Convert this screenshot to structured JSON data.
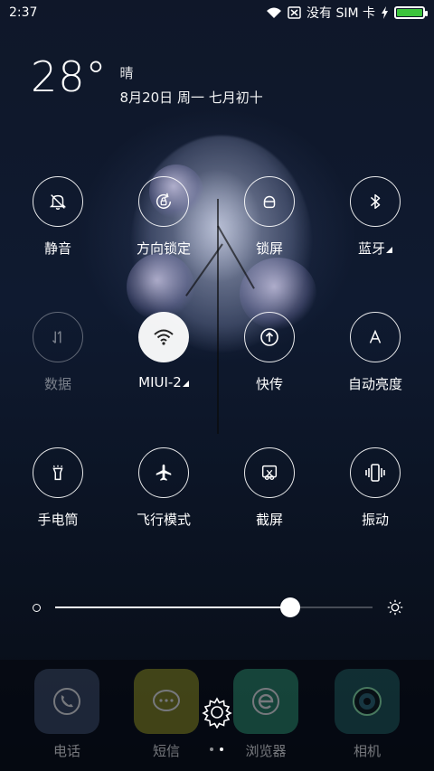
{
  "status_bar": {
    "time": "2:37",
    "sim_text": "没有 SIM 卡",
    "battery_color": "#3cc43c"
  },
  "weather": {
    "temperature": "28°",
    "condition": "晴",
    "date": "8月20日 周一 七月初十"
  },
  "toggles": [
    {
      "label": "静音",
      "icon": "bell-off-icon",
      "state": "off"
    },
    {
      "label": "方向锁定",
      "icon": "rotation-lock-icon",
      "state": "off"
    },
    {
      "label": "锁屏",
      "icon": "lock-icon",
      "state": "off"
    },
    {
      "label": "蓝牙",
      "icon": "bluetooth-icon",
      "state": "off"
    },
    {
      "label": "数据",
      "icon": "data-arrows-icon",
      "state": "disabled"
    },
    {
      "label": "MIUI-2",
      "icon": "wifi-icon",
      "state": "on"
    },
    {
      "label": "快传",
      "icon": "upload-icon",
      "state": "off"
    },
    {
      "label": "自动亮度",
      "icon": "auto-brightness-icon",
      "state": "off"
    },
    {
      "label": "手电筒",
      "icon": "flashlight-icon",
      "state": "off"
    },
    {
      "label": "飞行模式",
      "icon": "airplane-icon",
      "state": "off"
    },
    {
      "label": "截屏",
      "icon": "screenshot-icon",
      "state": "off"
    },
    {
      "label": "振动",
      "icon": "vibrate-icon",
      "state": "off"
    }
  ],
  "brightness": {
    "level_percent": 74
  },
  "dock": {
    "apps": [
      {
        "label": "电话",
        "icon": "phone-icon",
        "color": "#3b4a66"
      },
      {
        "label": "短信",
        "icon": "message-icon",
        "color": "#8a8a1f"
      },
      {
        "label": "浏览器",
        "icon": "browser-icon",
        "color": "#2a8a6a"
      },
      {
        "label": "相机",
        "icon": "camera-icon",
        "color": "#1f5a5a"
      }
    ],
    "page_count": 2,
    "current_page": 2
  }
}
